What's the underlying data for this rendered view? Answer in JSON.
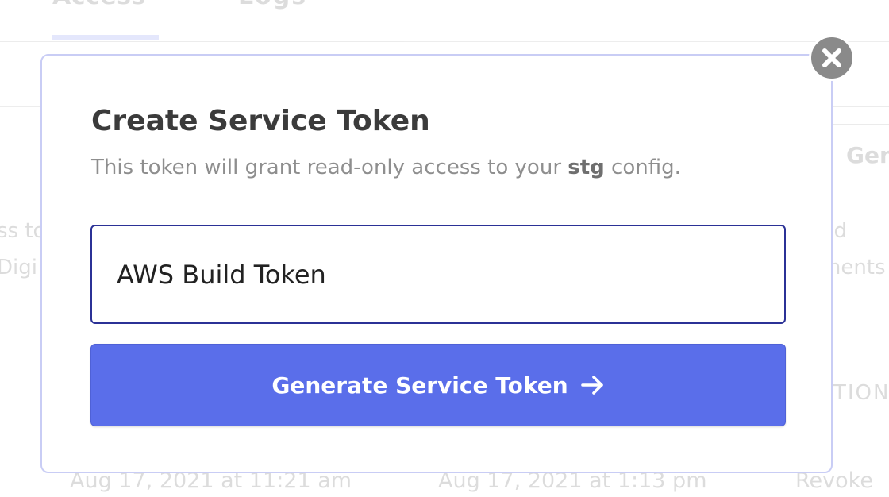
{
  "background": {
    "tabs": [
      {
        "label": "Access",
        "active": true
      },
      {
        "label": "Logs",
        "active": false
      }
    ],
    "generate_button_partial": "Gen",
    "description_left": [
      "ss to",
      "Digi"
    ],
    "description_right": [
      "ud",
      "ments"
    ],
    "column_header_partial": "TION",
    "row": {
      "created": "Aug 17, 2021 at 11:21 am",
      "last_used": "Aug 17, 2021 at 1:13 pm",
      "action": "Revoke"
    }
  },
  "modal": {
    "title": "Create Service Token",
    "subtitle_prefix": "This token will grant read-only access to your ",
    "subtitle_config": "stg",
    "subtitle_suffix": " config.",
    "token_input_value": "AWS Build Token",
    "submit_label": "Generate Service Token",
    "close_icon": "close-icon"
  },
  "colors": {
    "accent": "#5a6eea",
    "input_border": "#2b3196",
    "modal_border": "#c9cdf5",
    "close_bg": "#8a8a8a"
  }
}
